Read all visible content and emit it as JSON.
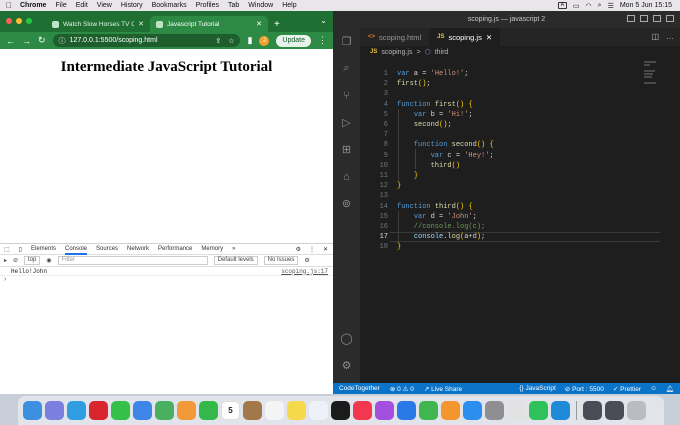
{
  "menubar": {
    "apple_glyph": "",
    "app_name": "Chrome",
    "items": [
      "File",
      "Edit",
      "View",
      "History",
      "Bookmarks",
      "Profiles",
      "Tab",
      "Window",
      "Help"
    ],
    "input_indicator": "A",
    "datetime": "Mon 5 Jun  15:15"
  },
  "chrome": {
    "tabs": [
      {
        "title": "Watch Slow Horses TV Online",
        "active": false
      },
      {
        "title": "Javascript Tutorial",
        "active": true
      }
    ],
    "new_tab_label": "+",
    "url": "127.0.0.1:5500/scoping.html",
    "profile_initial": "J",
    "update_label": "Update",
    "page_heading": "Intermediate JavaScript Tutorial"
  },
  "devtools": {
    "tabs": [
      "Elements",
      "Console",
      "Sources",
      "Network",
      "Performance",
      "Memory"
    ],
    "active_tab": "Console",
    "more_tabs": "»",
    "context": "top",
    "filter_placeholder": "Filter",
    "levels": "Default levels",
    "issues": "No Issues",
    "console_output": [
      {
        "text": "Hello!John",
        "source": "scoping.js:17"
      }
    ],
    "prompt": "›"
  },
  "vscode": {
    "window_title": "scoping.js — javascript 2",
    "tabs": [
      {
        "name": "scoping.html",
        "icon": "html-icon",
        "active": false
      },
      {
        "name": "scoping.js",
        "icon": "js-icon",
        "active": true
      }
    ],
    "js_badge": "JS",
    "html_badge": "<>",
    "breadcrumb": {
      "file": "scoping.js",
      "separator": ">",
      "symbol": "third"
    },
    "code_lines": [
      "var a = 'Hello!';",
      "first();",
      "",
      "function first() {",
      "    var b = 'Hi!';",
      "    second();",
      "",
      "    function second() {",
      "        var c = 'Hey!';",
      "        third()",
      "    }",
      "}",
      "",
      "function third() {",
      "    var d = 'John';",
      "    //console.log(c);",
      "    console.log(a+d);",
      "}"
    ],
    "current_line": 17,
    "status": {
      "codetogether": "CodeTogether",
      "errors": "0",
      "warnings": "0",
      "live_share": "Live Share",
      "language": "JavaScript",
      "port": "Port : 5500",
      "prettier": "Prettier"
    }
  },
  "dock": {
    "apps": [
      {
        "name": "finder-icon",
        "color": "#3d8fe0"
      },
      {
        "name": "launchpad-icon",
        "color": "#7a7fe0"
      },
      {
        "name": "safari-icon",
        "color": "#2f9de0"
      },
      {
        "name": "opera-icon",
        "color": "#d9262e"
      },
      {
        "name": "messages-icon",
        "color": "#35c04a"
      },
      {
        "name": "mail-icon",
        "color": "#3d86e8"
      },
      {
        "name": "maps-icon",
        "color": "#48b060"
      },
      {
        "name": "photos-icon",
        "color": "#f29a3a"
      },
      {
        "name": "facetime-icon",
        "color": "#34b84a"
      },
      {
        "name": "calendar-icon",
        "color": "#ffffff"
      },
      {
        "name": "brown-app-icon",
        "color": "#a2784a"
      },
      {
        "name": "reminders-icon",
        "color": "#f4f4f4"
      },
      {
        "name": "notes-icon",
        "color": "#f6d94a"
      },
      {
        "name": "freeform-icon",
        "color": "#eef2f8"
      },
      {
        "name": "appletv-icon",
        "color": "#1b1b1b"
      },
      {
        "name": "music-icon",
        "color": "#f3374f"
      },
      {
        "name": "podcasts-icon",
        "color": "#a54fe0"
      },
      {
        "name": "keynote-icon",
        "color": "#2b78e8"
      },
      {
        "name": "numbers-icon",
        "color": "#3fb64f"
      },
      {
        "name": "pages-icon",
        "color": "#f3962e"
      },
      {
        "name": "appstore-icon",
        "color": "#2c8ff0"
      },
      {
        "name": "system-settings-icon",
        "color": "#8e8e93"
      },
      {
        "name": "chrome-icon",
        "color": "#e2e2e2"
      },
      {
        "name": "whatsapp-icon",
        "color": "#2fc25a"
      },
      {
        "name": "vscode-icon",
        "color": "#1f8ad8"
      },
      {
        "name": "window-thumb-icon",
        "color": "#4a4d55"
      },
      {
        "name": "window-thumb-icon-2",
        "color": "#4a4d55"
      },
      {
        "name": "trash-icon",
        "color": "#b9bcc3"
      }
    ],
    "calendar_day": "5"
  }
}
